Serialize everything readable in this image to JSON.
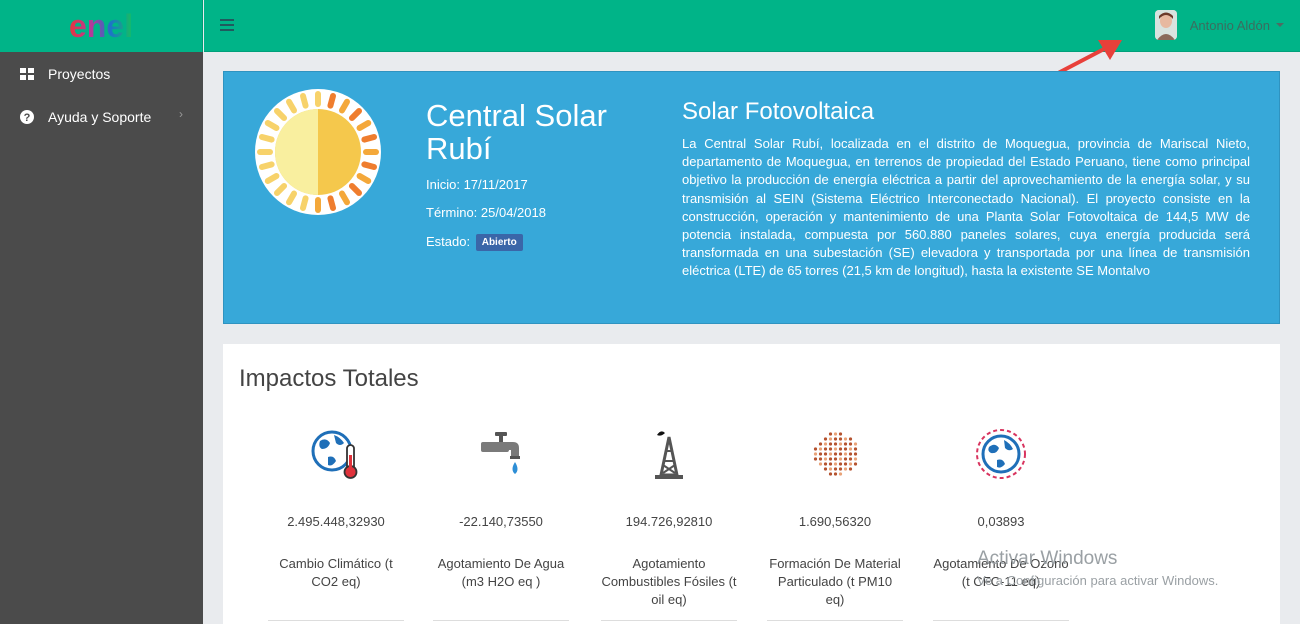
{
  "brand": {
    "logo_text": "enel"
  },
  "sidebar": {
    "items": [
      {
        "label": "Proyectos",
        "icon": "grid-icon"
      },
      {
        "label": "Ayuda y Soporte",
        "icon": "help-icon"
      }
    ]
  },
  "header": {
    "user_name": "Antonio Aldón"
  },
  "project": {
    "title": "Central Solar Rubí",
    "start_label": "Inicio: 17/11/2017",
    "end_label": "Término: 25/04/2018",
    "status_label": "Estado:",
    "status_value": "Abierto",
    "type": "Solar Fotovoltaica",
    "description": "La Central Solar Rubí, localizada en el distrito de Moquegua, provincia de Mariscal Nieto, departamento de Moquegua, en terrenos de propiedad del Estado Peruano, tiene como principal objetivo la producción de energía eléctrica a partir del aprovechamiento de la energía solar, y su transmisión al SEIN (Sistema Eléctrico Interconectado Nacional). El proyecto consiste en la construcción, operación y mantenimiento de una Planta Solar Fotovoltaica de 144,5 MW de potencia instalada, compuesta por 560.880 paneles solares, cuya energía producida será transformada en una subestación (SE) elevadora y transportada por una línea de transmisión eléctrica (LTE) de 65 torres (21,5 km de longitud), hasta la existente SE Montalvo"
  },
  "impacts": {
    "title": "Impactos Totales",
    "metrics": [
      {
        "value": "2.495.448,32930",
        "label": "Cambio Climático (t CO2 eq)",
        "icon": "globe-thermometer-icon"
      },
      {
        "value": "-22.140,73550",
        "label": "Agotamiento De Agua (m3 H2O eq )",
        "icon": "faucet-icon"
      },
      {
        "value": "194.726,92810",
        "label": "Agotamiento Combustibles Fósiles (t oil eq)",
        "icon": "oil-derrick-icon"
      },
      {
        "value": "1.690,56320",
        "label": "Formación De Material Particulado (t PM10 eq)",
        "icon": "particles-icon"
      },
      {
        "value": "0,03893",
        "label": "Agotamiento De Ozono (t CFC-11 eq)",
        "icon": "ozone-globe-icon"
      }
    ]
  },
  "watermark": {
    "line1": "Activar Windows",
    "line2": "Ve a Configuración para activar Windows."
  },
  "colors": {
    "accent": "#00b488",
    "hero": "#37a8d9",
    "sidebar": "#4b4b4b"
  }
}
